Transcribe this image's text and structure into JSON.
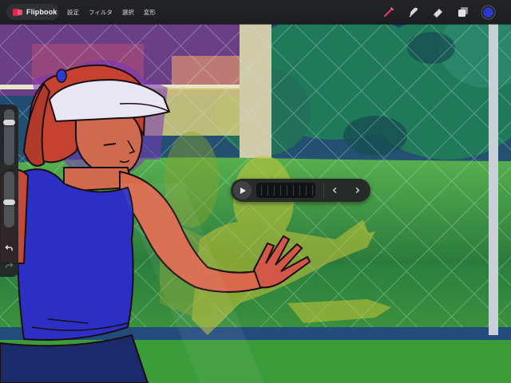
{
  "app": {
    "name": "Flipbook",
    "logo_icon": "flipbook-logo-icon",
    "brand_color": "#e0294f"
  },
  "menu": [
    {
      "label": "設定"
    },
    {
      "label": "フィルタ"
    },
    {
      "label": "選択"
    },
    {
      "label": "変形"
    }
  ],
  "toolbar": {
    "tools": [
      {
        "icon": "brush-icon",
        "active": true,
        "color": "#e7356a"
      },
      {
        "icon": "smudge-icon",
        "active": false
      },
      {
        "icon": "eraser-icon",
        "active": false
      },
      {
        "icon": "layers-icon",
        "active": false
      }
    ],
    "current_color": "#2c38c9"
  },
  "sidebar": {
    "brush_size_level": 0.2,
    "opacity_level": 0.55,
    "undo_icon": "undo-icon",
    "redo_icon": "redo-icon"
  },
  "player": {
    "play_icon": "play-icon",
    "prev_icon": "chevron-left-icon",
    "next_icon": "chevron-right-icon",
    "frame_count": 9
  },
  "canvas": {
    "description_icon": "artwork-canvas",
    "palette": {
      "hair": "#c8432e",
      "skin": "#d86a4b",
      "shirt": "#2b2fc4",
      "visor": "#e9e6f4",
      "hedge": "#3e9a4c",
      "court": "#2f8a42",
      "ghost": "#c7c436"
    }
  }
}
